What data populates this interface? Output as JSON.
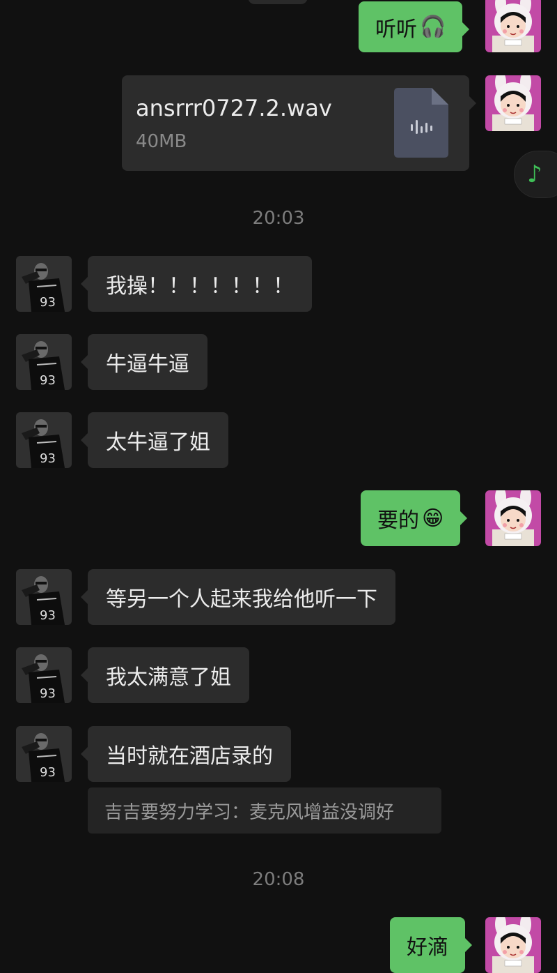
{
  "messages": {
    "m1_text": "听听",
    "m1_emoji": "🎧",
    "file_name": "ansrrr0727.2.wav",
    "file_size": "40MB",
    "time1": "20:03",
    "m2": "我操！！！！！！！",
    "m3": "牛逼牛逼",
    "m4": "太牛逼了姐",
    "m5_text": "要的",
    "m5_emoji": "😁",
    "m6": "等另一个人起来我给他听一下",
    "m7": "我太满意了姐",
    "m8": "当时就在酒店录的",
    "quote": "吉吉要努力学习：麦克风增益没调好",
    "time2": "20:08",
    "m9": "好滴"
  },
  "icons": {
    "music": "music-note-icon",
    "audio_file": "audio-file-icon"
  },
  "colors": {
    "background": "#111111",
    "incoming_bubble": "#2c2c2c",
    "outgoing_bubble": "#5fc266",
    "music_icon": "#3fbf57"
  }
}
